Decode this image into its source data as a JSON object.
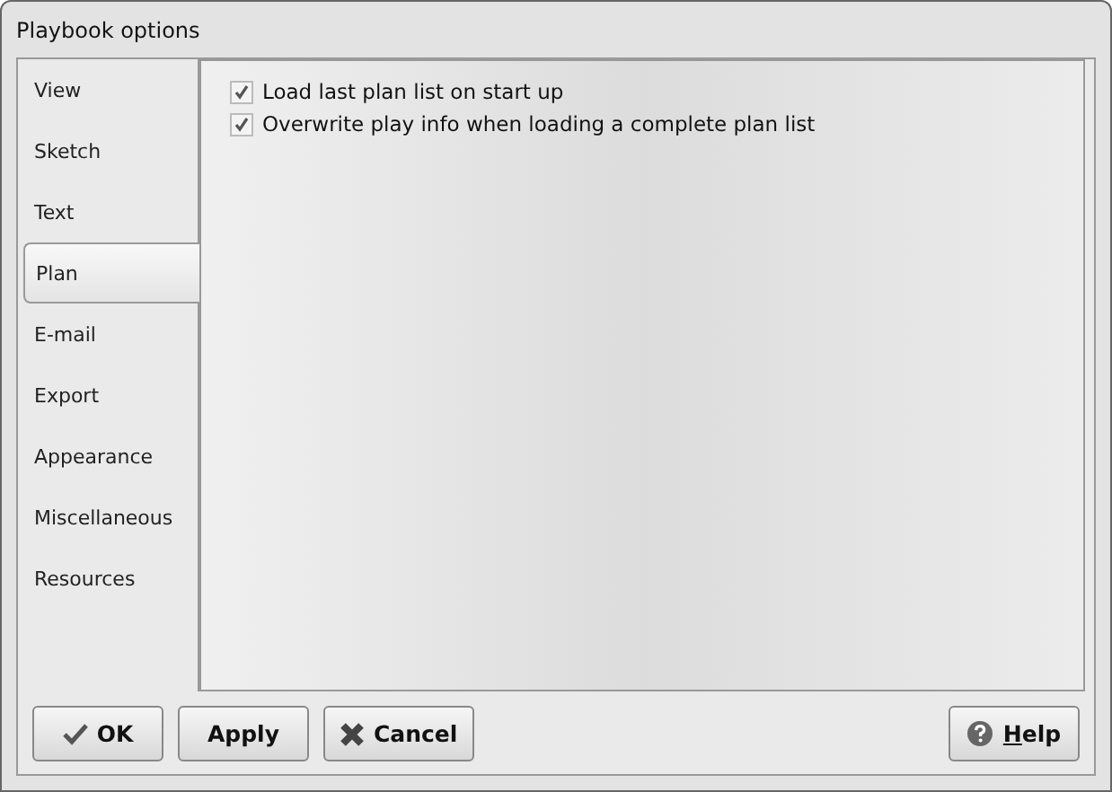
{
  "window": {
    "title": "Playbook options"
  },
  "tabs": [
    {
      "label": "View",
      "selected": false
    },
    {
      "label": "Sketch",
      "selected": false
    },
    {
      "label": "Text",
      "selected": false
    },
    {
      "label": "Plan",
      "selected": true
    },
    {
      "label": "E-mail",
      "selected": false
    },
    {
      "label": "Export",
      "selected": false
    },
    {
      "label": "Appearance",
      "selected": false
    },
    {
      "label": "Miscellaneous",
      "selected": false
    },
    {
      "label": "Resources",
      "selected": false
    }
  ],
  "options": [
    {
      "label": "Load last plan list on start up",
      "checked": true
    },
    {
      "label": "Overwrite play info when loading a complete plan list",
      "checked": true
    }
  ],
  "buttons": [
    {
      "kind": "ok",
      "label": "OK"
    },
    {
      "kind": "apply",
      "label": "Apply"
    },
    {
      "kind": "cancel",
      "label": "Cancel"
    },
    {
      "kind": "help",
      "label": "Help",
      "first_letter_underlined": true
    }
  ]
}
